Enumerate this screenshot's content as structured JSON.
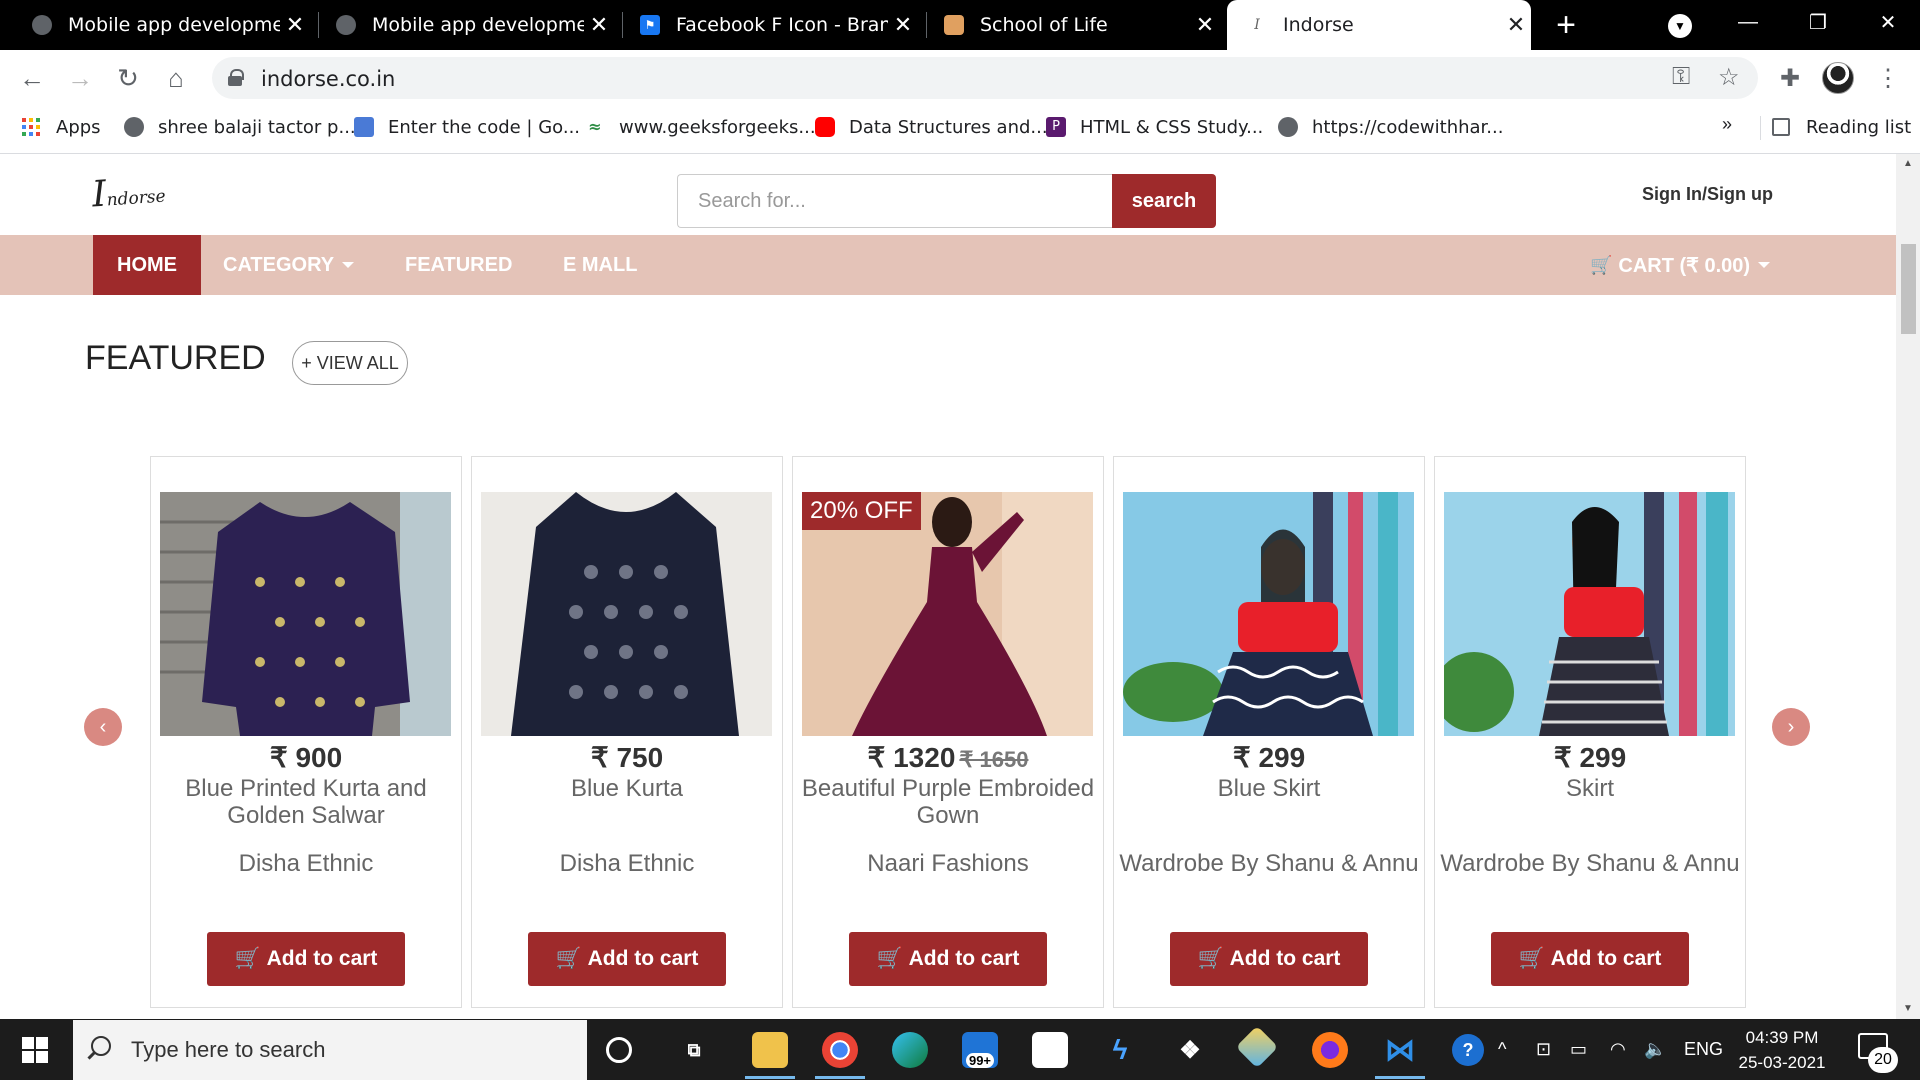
{
  "browser": {
    "tabs": [
      {
        "title": "Mobile app development",
        "icon": "globe-icon"
      },
      {
        "title": "Mobile app development",
        "icon": "globe-icon"
      },
      {
        "title": "Facebook F Icon - Brands",
        "icon": "flag-icon"
      },
      {
        "title": "School of Life",
        "icon": "person-icon"
      },
      {
        "title": "Indorse",
        "icon": "indorse-logo-icon"
      }
    ],
    "url": "indorse.co.in",
    "bookmarks": [
      {
        "label": "Apps",
        "icon": "apps-grid-icon"
      },
      {
        "label": "shree balaji tactor p...",
        "icon": "globe-icon"
      },
      {
        "label": "Enter the code | Go...",
        "icon": "google-classroom-icon"
      },
      {
        "label": "www.geeksforgeeks...",
        "icon": "geeksforgeeks-icon"
      },
      {
        "label": "Data Structures and...",
        "icon": "youtube-icon"
      },
      {
        "label": "HTML & CSS Study...",
        "icon": "p-icon"
      },
      {
        "label": "https://codewithhar...",
        "icon": "globe-icon"
      }
    ],
    "bookmarks_more": "»",
    "reading_list": "Reading list"
  },
  "site": {
    "logo_initial": "I",
    "logo_rest": "ndorse",
    "search_placeholder": "Search for...",
    "search_button": "search",
    "signin": "Sign In/Sign up",
    "nav": {
      "home": "HOME",
      "category": "CATEGORY",
      "featured": "FEATURED",
      "emall": "E MALL",
      "cart": "CART (₹ 0.00)"
    },
    "section_title": "FEATURED",
    "view_all": "+ VIEW ALL",
    "add_to_cart": "Add to cart",
    "products": [
      {
        "price": "₹ 900",
        "old_price": "",
        "name": "Blue Printed Kurta and Golden Salwar",
        "brand": "Disha Ethnic",
        "badge": ""
      },
      {
        "price": "₹ 750",
        "old_price": "",
        "name": "Blue Kurta",
        "brand": "Disha Ethnic",
        "badge": ""
      },
      {
        "price": "₹ 1320",
        "old_price": "₹ 1650",
        "name": "Beautiful Purple Embroided Gown",
        "brand": "Naari Fashions",
        "badge": "20% OFF"
      },
      {
        "price": "₹ 299",
        "old_price": "",
        "name": "Blue Skirt",
        "brand": "Wardrobe By Shanu & Annu",
        "badge": ""
      },
      {
        "price": "₹ 299",
        "old_price": "",
        "name": "Skirt",
        "brand": "Wardrobe By Shanu & Annu",
        "badge": ""
      }
    ]
  },
  "taskbar": {
    "search_placeholder": "Type here to search",
    "mail_badge": "99+",
    "language": "ENG",
    "time": "04:39 PM",
    "date": "25-03-2021",
    "notifications": "20"
  },
  "colors": {
    "brand_red": "#9e2a2b",
    "nav_bg": "#e4c3b8",
    "arrow_bg": "#d98982"
  }
}
